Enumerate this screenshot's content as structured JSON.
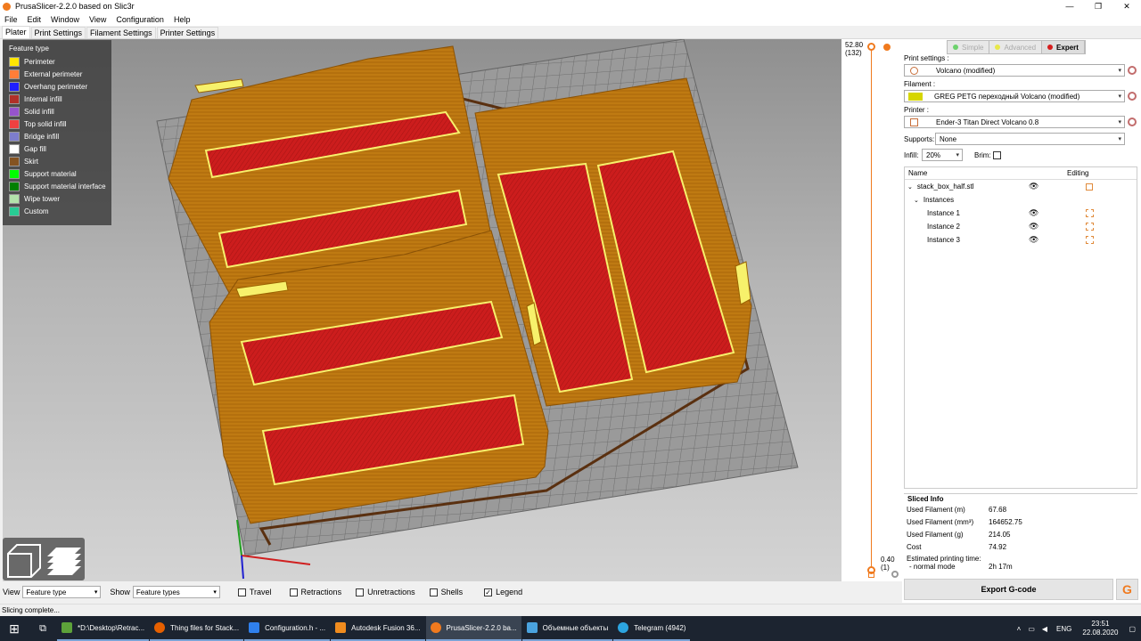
{
  "window": {
    "title": "PrusaSlicer-2.2.0 based on Slic3r",
    "minimize": "—",
    "maximize": "❐",
    "close": "✕"
  },
  "menu": [
    "File",
    "Edit",
    "Window",
    "View",
    "Configuration",
    "Help"
  ],
  "tabs": [
    "Plater",
    "Print Settings",
    "Filament Settings",
    "Printer Settings"
  ],
  "legend": {
    "title": "Feature type",
    "items": [
      {
        "label": "Perimeter",
        "color": "#ffe600"
      },
      {
        "label": "External perimeter",
        "color": "#ff7d38"
      },
      {
        "label": "Overhang perimeter",
        "color": "#1f1fff"
      },
      {
        "label": "Internal infill",
        "color": "#b03029"
      },
      {
        "label": "Solid infill",
        "color": "#9654cc"
      },
      {
        "label": "Top solid infill",
        "color": "#f04040"
      },
      {
        "label": "Bridge infill",
        "color": "#7d7dcc"
      },
      {
        "label": "Gap fill",
        "color": "#ffffff"
      },
      {
        "label": "Skirt",
        "color": "#845321"
      },
      {
        "label": "Support material",
        "color": "#00ff00"
      },
      {
        "label": "Support material interface",
        "color": "#008000"
      },
      {
        "label": "Wipe tower",
        "color": "#b3e3ab"
      },
      {
        "label": "Custom",
        "color": "#28cc94"
      }
    ]
  },
  "layer_slider": {
    "top_height": "52.80",
    "top_layer": "(132)",
    "bottom_height": "0.40",
    "bottom_layer": "(1)"
  },
  "mode": {
    "simple": "Simple",
    "advanced": "Advanced",
    "expert": "Expert"
  },
  "settings": {
    "print_label": "Print settings :",
    "print_value": "Volcano (modified)",
    "filament_label": "Filament :",
    "filament_value": "GREG PETG переходный Volcano (modified)",
    "filament_color": "#d6d600",
    "printer_label": "Printer :",
    "printer_value": "Ender-3 Titan Direct Volcano 0.8",
    "supports_label": "Supports:",
    "supports_value": "None",
    "infill_label": "Infill:",
    "infill_value": "20%",
    "brim_label": "Brim:"
  },
  "object_list": {
    "col_name": "Name",
    "col_editing": "Editing",
    "object": "stack_box_half.stl",
    "instances_label": "Instances",
    "instances": [
      "Instance 1",
      "Instance 2",
      "Instance 3"
    ]
  },
  "sliced_info": {
    "title": "Sliced Info",
    "rows": [
      {
        "k": "Used Filament (m)",
        "v": "67.68"
      },
      {
        "k": "Used Filament (mm³)",
        "v": "164652.75"
      },
      {
        "k": "Used Filament (g)",
        "v": "214.05"
      },
      {
        "k": "Cost",
        "v": "74.92"
      }
    ],
    "time_label": "Estimated printing time:",
    "mode_label": "- normal mode",
    "time_value": "2h 17m"
  },
  "export_label": "Export G-code",
  "bottom_bar": {
    "view_label": "View",
    "view_value": "Feature type",
    "show_label": "Show",
    "show_value": "Feature types",
    "checkboxes": [
      {
        "label": "Travel",
        "checked": false
      },
      {
        "label": "Retractions",
        "checked": false
      },
      {
        "label": "Unretractions",
        "checked": false
      },
      {
        "label": "Shells",
        "checked": false
      },
      {
        "label": "Legend",
        "checked": true
      }
    ]
  },
  "status": "Slicing complete...",
  "taskbar": {
    "tasks": [
      {
        "label": "*D:\\Desktop\\Retrac...",
        "color": "#5da23a"
      },
      {
        "label": "Thing files for Stack...",
        "color": "#e66000"
      },
      {
        "label": "Configuration.h - ...",
        "color": "#2f80ed"
      },
      {
        "label": "Autodesk Fusion 36...",
        "color": "#f08c1e"
      },
      {
        "label": "PrusaSlicer-2.2.0 ba...",
        "color": "#f07a1e"
      },
      {
        "label": "Объемные объекты",
        "color": "#4aa3df"
      },
      {
        "label": "Telegram (4942)",
        "color": "#2ca5e0"
      }
    ],
    "lang": "ENG",
    "time": "23:51",
    "date": "22.08.2020"
  }
}
